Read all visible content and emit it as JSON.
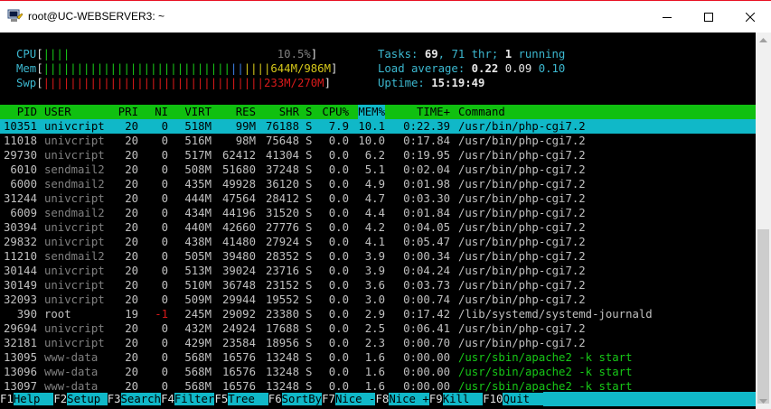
{
  "window": {
    "title": "root@UC-WEBSERVER3: ~",
    "minimize_label": "minimize",
    "maximize_label": "maximize",
    "close_label": "close"
  },
  "meters": {
    "cpu": {
      "label": "CPU",
      "bar": "||||",
      "value": "10.5%",
      "fraction": 0.105
    },
    "mem": {
      "label": "Mem",
      "bar_green": "||||||||||||||||||||||||||||",
      "bar_blue": "||",
      "bar_yellow": "||||",
      "value": "644M/986M"
    },
    "swp": {
      "label": "Swp",
      "bar": "|||||||||||||||||||||||||||||||||",
      "value": "233M/270M"
    }
  },
  "stats": {
    "tasks_label": "Tasks: ",
    "tasks_value": "69",
    "thr_text": ", 71 thr; ",
    "running_value": "1",
    "running_text": " running",
    "load_label": "Load average: ",
    "load1": "0.22",
    "load5": "0.09",
    "load15": "0.10",
    "uptime_label": "Uptime: ",
    "uptime_value": "15:19:49"
  },
  "columns": [
    "PID",
    "USER",
    "PRI",
    "NI",
    "VIRT",
    "RES",
    "SHR",
    "S",
    "CPU%",
    "MEM%",
    "TIME+",
    "Command"
  ],
  "sorted_column": "MEM%",
  "processes": [
    {
      "pid": "10351",
      "user": "univcript",
      "pri": "20",
      "ni": "0",
      "virt": "518M",
      "res": "99M",
      "shr": "76188",
      "s": "S",
      "cpu": "7.9",
      "mem": "10.1",
      "time": "0:22.39",
      "cmd": "/usr/bin/php-cgi7.2",
      "selected": true
    },
    {
      "pid": "11018",
      "user": "univcript",
      "pri": "20",
      "ni": "0",
      "virt": "516M",
      "res": "98M",
      "shr": "75648",
      "s": "S",
      "cpu": "0.0",
      "mem": "10.0",
      "time": "0:17.84",
      "cmd": "/usr/bin/php-cgi7.2"
    },
    {
      "pid": "29730",
      "user": "univcript",
      "pri": "20",
      "ni": "0",
      "virt": "517M",
      "res": "62412",
      "shr": "41304",
      "s": "S",
      "cpu": "0.0",
      "mem": "6.2",
      "time": "0:19.95",
      "cmd": "/usr/bin/php-cgi7.2"
    },
    {
      "pid": "6010",
      "user": "sendmail2",
      "pri": "20",
      "ni": "0",
      "virt": "508M",
      "res": "51680",
      "shr": "37248",
      "s": "S",
      "cpu": "0.0",
      "mem": "5.1",
      "time": "0:02.04",
      "cmd": "/usr/bin/php-cgi7.2"
    },
    {
      "pid": "6000",
      "user": "sendmail2",
      "pri": "20",
      "ni": "0",
      "virt": "435M",
      "res": "49928",
      "shr": "36120",
      "s": "S",
      "cpu": "0.0",
      "mem": "4.9",
      "time": "0:01.98",
      "cmd": "/usr/bin/php-cgi7.2"
    },
    {
      "pid": "31244",
      "user": "univcript",
      "pri": "20",
      "ni": "0",
      "virt": "444M",
      "res": "47564",
      "shr": "28412",
      "s": "S",
      "cpu": "0.0",
      "mem": "4.7",
      "time": "0:03.30",
      "cmd": "/usr/bin/php-cgi7.2"
    },
    {
      "pid": "6009",
      "user": "sendmail2",
      "pri": "20",
      "ni": "0",
      "virt": "434M",
      "res": "44196",
      "shr": "31520",
      "s": "S",
      "cpu": "0.0",
      "mem": "4.4",
      "time": "0:01.84",
      "cmd": "/usr/bin/php-cgi7.2"
    },
    {
      "pid": "30394",
      "user": "univcript",
      "pri": "20",
      "ni": "0",
      "virt": "440M",
      "res": "42660",
      "shr": "27776",
      "s": "S",
      "cpu": "0.0",
      "mem": "4.2",
      "time": "0:04.05",
      "cmd": "/usr/bin/php-cgi7.2"
    },
    {
      "pid": "29832",
      "user": "univcript",
      "pri": "20",
      "ni": "0",
      "virt": "438M",
      "res": "41480",
      "shr": "27924",
      "s": "S",
      "cpu": "0.0",
      "mem": "4.1",
      "time": "0:05.47",
      "cmd": "/usr/bin/php-cgi7.2"
    },
    {
      "pid": "11210",
      "user": "sendmail2",
      "pri": "20",
      "ni": "0",
      "virt": "505M",
      "res": "39480",
      "shr": "28352",
      "s": "S",
      "cpu": "0.0",
      "mem": "3.9",
      "time": "0:00.34",
      "cmd": "/usr/bin/php-cgi7.2"
    },
    {
      "pid": "30144",
      "user": "univcript",
      "pri": "20",
      "ni": "0",
      "virt": "513M",
      "res": "39024",
      "shr": "23716",
      "s": "S",
      "cpu": "0.0",
      "mem": "3.9",
      "time": "0:04.24",
      "cmd": "/usr/bin/php-cgi7.2"
    },
    {
      "pid": "30149",
      "user": "univcript",
      "pri": "20",
      "ni": "0",
      "virt": "510M",
      "res": "36748",
      "shr": "23152",
      "s": "S",
      "cpu": "0.0",
      "mem": "3.6",
      "time": "0:03.73",
      "cmd": "/usr/bin/php-cgi7.2"
    },
    {
      "pid": "32093",
      "user": "univcript",
      "pri": "20",
      "ni": "0",
      "virt": "509M",
      "res": "29944",
      "shr": "19552",
      "s": "S",
      "cpu": "0.0",
      "mem": "3.0",
      "time": "0:00.74",
      "cmd": "/usr/bin/php-cgi7.2"
    },
    {
      "pid": "390",
      "user": "root",
      "pri": "19",
      "ni": "-1",
      "virt": "245M",
      "res": "29092",
      "shr": "23380",
      "s": "S",
      "cpu": "0.0",
      "mem": "2.9",
      "time": "0:17.42",
      "cmd": "/lib/systemd/systemd-journald",
      "root": true
    },
    {
      "pid": "29694",
      "user": "univcript",
      "pri": "20",
      "ni": "0",
      "virt": "432M",
      "res": "24924",
      "shr": "17688",
      "s": "S",
      "cpu": "0.0",
      "mem": "2.5",
      "time": "0:06.41",
      "cmd": "/usr/bin/php-cgi7.2"
    },
    {
      "pid": "32181",
      "user": "univcript",
      "pri": "20",
      "ni": "0",
      "virt": "429M",
      "res": "23584",
      "shr": "18956",
      "s": "S",
      "cpu": "0.0",
      "mem": "2.3",
      "time": "0:00.70",
      "cmd": "/usr/bin/php-cgi7.2"
    },
    {
      "pid": "13095",
      "user": "www-data",
      "pri": "20",
      "ni": "0",
      "virt": "568M",
      "res": "16576",
      "shr": "13248",
      "s": "S",
      "cpu": "0.0",
      "mem": "1.6",
      "time": "0:00.00",
      "cmd": "/usr/sbin/apache2 -k start",
      "green_cmd": true
    },
    {
      "pid": "13096",
      "user": "www-data",
      "pri": "20",
      "ni": "0",
      "virt": "568M",
      "res": "16576",
      "shr": "13248",
      "s": "S",
      "cpu": "0.0",
      "mem": "1.6",
      "time": "0:00.00",
      "cmd": "/usr/sbin/apache2 -k start",
      "green_cmd": true
    },
    {
      "pid": "13097",
      "user": "www-data",
      "pri": "20",
      "ni": "0",
      "virt": "568M",
      "res": "16576",
      "shr": "13248",
      "s": "S",
      "cpu": "0.0",
      "mem": "1.6",
      "time": "0:00.00",
      "cmd": "/usr/sbin/apache2 -k start",
      "green_cmd": true
    }
  ],
  "function_keys": [
    {
      "key": "F1",
      "label": "Help  "
    },
    {
      "key": "F2",
      "label": "Setup "
    },
    {
      "key": "F3",
      "label": "Search"
    },
    {
      "key": "F4",
      "label": "Filter"
    },
    {
      "key": "F5",
      "label": "Tree  "
    },
    {
      "key": "F6",
      "label": "SortBy"
    },
    {
      "key": "F7",
      "label": "Nice -"
    },
    {
      "key": "F8",
      "label": "Nice +"
    },
    {
      "key": "F9",
      "label": "Kill  "
    },
    {
      "key": "F10",
      "label": "Quit  "
    }
  ],
  "colors": {
    "terminal_bg": "#000000",
    "header_bg": "#10c010",
    "selected_bg": "#10b8c8",
    "accent_cyan": "#3cb8d0",
    "green": "#17c817",
    "red": "#d81a1a"
  }
}
